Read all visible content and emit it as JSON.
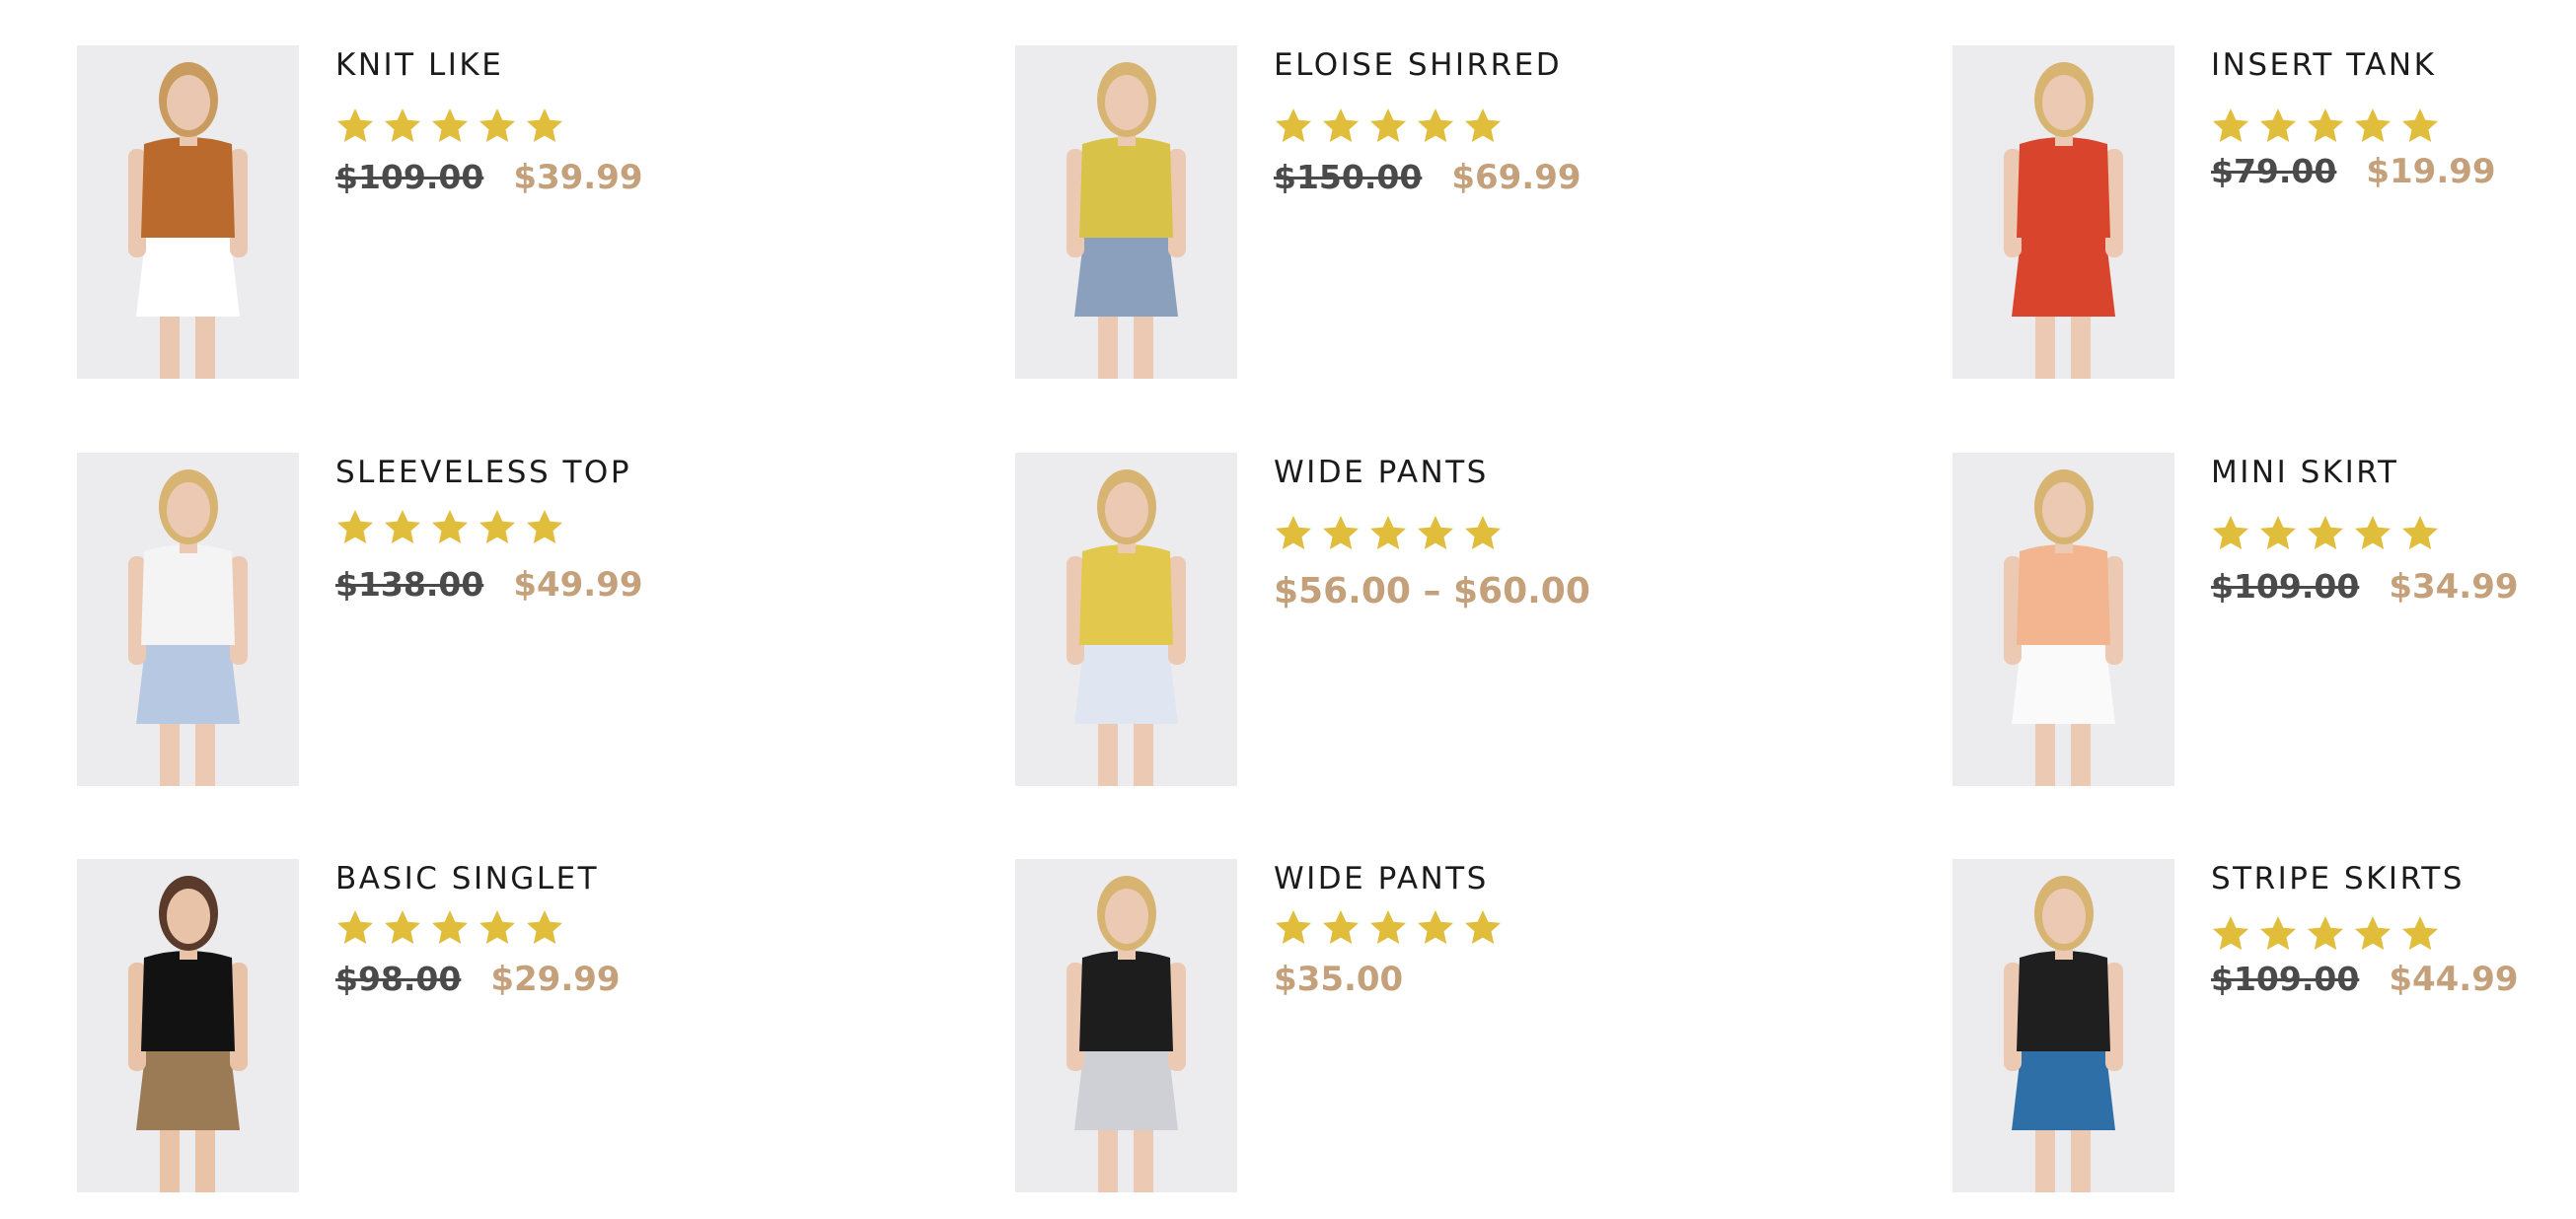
{
  "colors": {
    "star": "#e1bd3c",
    "price_sale": "#c4a07b",
    "price_old": "#4a4a4a",
    "title": "#1b1b1b",
    "thumb_bg": "#ececee"
  },
  "products": [
    {
      "title": "KNIT LIKE",
      "rating": 5,
      "old_price": "$109.00",
      "price": "$39.99",
      "thumbnail": {
        "label": "knit-like-photo",
        "top": "#b96a2c",
        "bottom": "#ffffff",
        "skin": "#e9c7b0",
        "hair": "#c99b5e"
      }
    },
    {
      "title": "ELOISE SHIRRED",
      "rating": 5,
      "old_price": "$150.00",
      "price": "$69.99",
      "thumbnail": {
        "label": "eloise-shirred-photo",
        "top": "#d8c348",
        "bottom": "#8ba0bd",
        "skin": "#ecc9b3",
        "hair": "#d8b473"
      }
    },
    {
      "title": "INSERT TANK",
      "rating": 5,
      "old_price": "$79.00",
      "price": "$19.99",
      "thumbnail": {
        "label": "insert-tank-photo",
        "top": "#d8452c",
        "bottom": "#d8452c",
        "skin": "#ecc9b3",
        "hair": "#d8b473"
      }
    },
    {
      "title": "SLEEVELESS TOP",
      "rating": 5,
      "old_price": "$138.00",
      "price": "$49.99",
      "thumbnail": {
        "label": "sleeveless-top-photo",
        "top": "#f4f4f4",
        "bottom": "#b7c8e3",
        "skin": "#ecc9b3",
        "hair": "#d8b473"
      }
    },
    {
      "title": "WIDE PANTS",
      "rating": 5,
      "price_range": "$56.00 – $60.00",
      "thumbnail": {
        "label": "wide-pants-yellow-photo",
        "top": "#e3c84e",
        "bottom": "#dfe6f1",
        "skin": "#ecc9b3",
        "hair": "#d8b473"
      }
    },
    {
      "title": "MINI SKIRT",
      "rating": 5,
      "old_price": "$109.00",
      "price": "$34.99",
      "thumbnail": {
        "label": "mini-skirt-photo",
        "top": "#f2b58f",
        "bottom": "#fafafa",
        "skin": "#ecc9b3",
        "hair": "#d8b473"
      }
    },
    {
      "title": "BASIC SINGLET",
      "rating": 5,
      "old_price": "$98.00",
      "price": "$29.99",
      "thumbnail": {
        "label": "basic-singlet-photo",
        "top": "#121212",
        "bottom": "#9a7b55",
        "skin": "#e9c3a8",
        "hair": "#5a3a2a"
      }
    },
    {
      "title": "WIDE PANTS",
      "rating": 5,
      "price": "$35.00",
      "thumbnail": {
        "label": "wide-pants-black-photo",
        "top": "#1d1d1d",
        "bottom": "#cfcfd6",
        "skin": "#ecc9b3",
        "hair": "#d8b473"
      }
    },
    {
      "title": "STRIPE SKIRTS",
      "rating": 5,
      "old_price": "$109.00",
      "price": "$44.99",
      "thumbnail": {
        "label": "stripe-skirts-photo",
        "top": "#1f1f1f",
        "bottom": "#2f6fa8",
        "skin": "#ecc9b3",
        "hair": "#d8b473"
      }
    }
  ]
}
